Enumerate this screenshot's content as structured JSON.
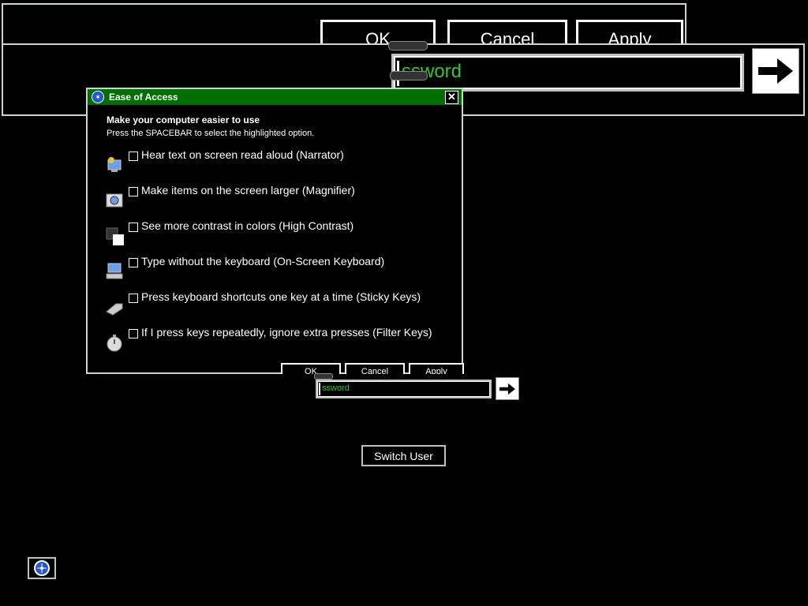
{
  "magnifier": {
    "buttons": {
      "ok": "OK",
      "cancel": "Cancel",
      "apply": "Apply"
    },
    "password_text": "ssword"
  },
  "dialog": {
    "title": "Ease of Access",
    "close_glyph": "✕",
    "heading": "Make your computer easier to use",
    "subheading": "Press the SPACEBAR to select the highlighted option.",
    "options": [
      {
        "label": "Hear text on screen read aloud (Narrator)",
        "icon": "narrator-icon",
        "checked": false
      },
      {
        "label": "Make items on the screen larger (Magnifier)",
        "icon": "magnifier-icon",
        "checked": false
      },
      {
        "label": "See more contrast in colors (High Contrast)",
        "icon": "high-contrast-icon",
        "checked": false
      },
      {
        "label": "Type without the keyboard (On-Screen Keyboard)",
        "icon": "on-screen-keyboard-icon",
        "checked": false
      },
      {
        "label": "Press keyboard shortcuts one key at a time (Sticky Keys)",
        "icon": "sticky-keys-icon",
        "checked": false
      },
      {
        "label": "If I press keys repeatedly, ignore extra presses (Filter Keys)",
        "icon": "filter-keys-icon",
        "checked": false
      }
    ],
    "buttons": {
      "ok": "OK",
      "cancel": "Cancel",
      "apply": "Apply"
    }
  },
  "login": {
    "password_text": "ssword",
    "switch_user": "Switch User"
  },
  "colors": {
    "title_bar": "#006e00",
    "text_green": "#2ec82e",
    "background": "#000000"
  }
}
